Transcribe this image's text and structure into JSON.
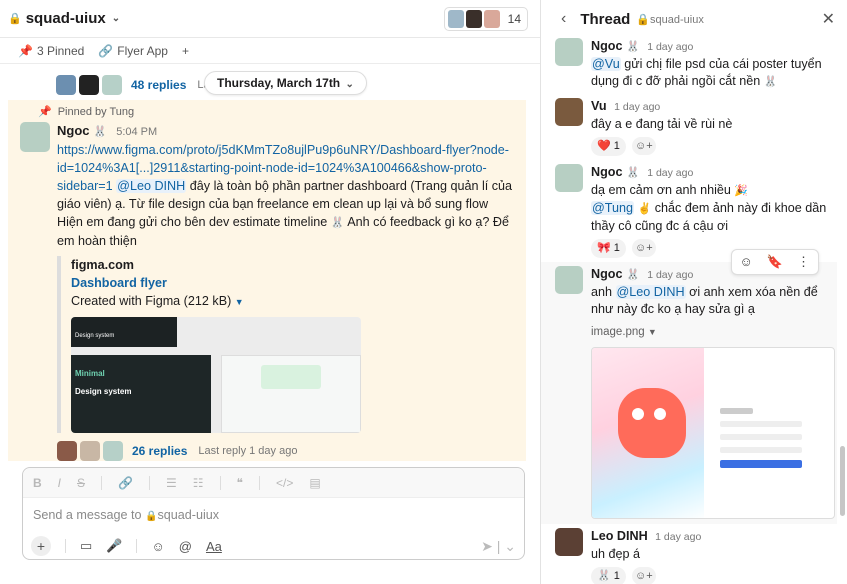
{
  "channel": {
    "name": "squad-uiux",
    "member_count": "14"
  },
  "bookmarks": {
    "pinned": "3 Pinned",
    "app": "Flyer App",
    "add": "+"
  },
  "messages_area": {
    "prev_thread": {
      "replies": "48 replies",
      "last_reply": "Last r"
    },
    "date_divider": "Thursday, March 17th",
    "pinned_by": "Pinned by Tung",
    "message": {
      "sender": "Ngoc",
      "time": "5:04 PM",
      "link": "https://www.figma.com/proto/j5dKMmTZo8ujlPu9p6uNRY/Dashboard-flyer?node-id=1024%3A1[...]2911&starting-point-node-id=1024%3A100466&show-proto-sidebar=1",
      "mention": "@Leo DINH",
      "text1": " đây là toàn bộ phần partner dashboard (Trang quản lí của giáo viên) ạ. Từ file design của bạn freelance em clean up lại và bổ sung flow",
      "text2": "Hiện em đang gửi cho bên dev estimate timeline",
      "text3": " Anh có feedback gì ko ạ? Để em hoàn thiện",
      "unfurl": {
        "site": "figma.com",
        "title": "Dashboard flyer",
        "desc": "Created with Figma (212 kB)",
        "preview_title1": "Minimal",
        "preview_title2": "Design system",
        "preview_small": "Design system"
      },
      "replies": "26 replies",
      "last_reply": "Last reply 1 day ago"
    }
  },
  "composer": {
    "placeholder": "Send a message to",
    "channel": "squad-uiux",
    "format_labels": [
      "B",
      "I",
      "S",
      "link",
      "ol",
      "ul",
      "quote",
      "code",
      "codeblock"
    ],
    "aa": "Aa"
  },
  "thread": {
    "title": "Thread",
    "channel": "squad-uiux",
    "messages": [
      {
        "sender": "Ngoc",
        "time": "1 day ago",
        "mention": "@Vu",
        "text": " gửi chị file psd của cái poster tuyển dụng đi c đỡ phải ngồi cắt nền"
      },
      {
        "sender": "Vu",
        "time": "1 day ago",
        "text": "đây a e đang tải về rùi nè",
        "reaction": {
          "emoji": "❤️",
          "count": "1"
        }
      },
      {
        "sender": "Ngoc",
        "time": "1 day ago",
        "text_a": "dạ em cảm ơn anh nhiều",
        "mention": "@Tung",
        "text_b": " chắc đem ảnh này đi khoe dần thầy cô cũng đc á cậu ơi",
        "reaction": {
          "emoji": "🎀",
          "count": "1"
        }
      },
      {
        "sender": "Ngoc",
        "time": "1 day ago",
        "pre": "anh ",
        "mention": "@Leo DINH",
        "text": " ơi anh xem xóa nền để như này đc ko ạ hay sửa gì ạ",
        "attachment": "image.png"
      },
      {
        "sender": "Leo DINH",
        "time": "1 day ago",
        "text": "uh đẹp á",
        "reaction": {
          "emoji": "🐰",
          "count": "1"
        }
      }
    ]
  },
  "colors": {
    "link": "#1264a3",
    "pinned_bg": "#fef6e6",
    "heart": "#e01e5a"
  }
}
